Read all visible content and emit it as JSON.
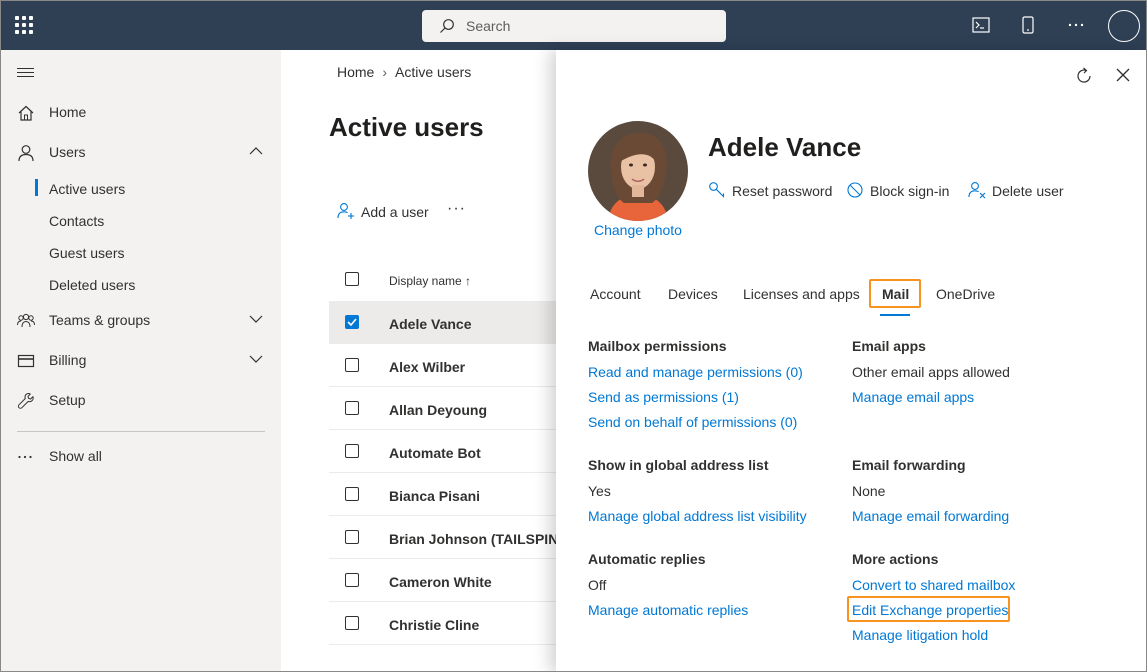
{
  "topbar": {
    "search_placeholder": "Search",
    "icons": [
      "app-launcher-icon",
      "search-icon",
      "terminal-icon",
      "mobile-icon",
      "more-icon",
      "profile-icon"
    ]
  },
  "nav": {
    "home": "Home",
    "users": "Users",
    "active_users": "Active users",
    "contacts": "Contacts",
    "guest_users": "Guest users",
    "deleted_users": "Deleted users",
    "teams_groups": "Teams & groups",
    "billing": "Billing",
    "setup": "Setup",
    "show_all": "Show all"
  },
  "main": {
    "breadcrumb_home": "Home",
    "breadcrumb_current": "Active users",
    "title": "Active users",
    "add_user": "Add a user",
    "more": "···",
    "col_display_name": "Display name ↑",
    "rows": [
      {
        "name": "Adele Vance",
        "selected": true
      },
      {
        "name": "Alex Wilber",
        "selected": false
      },
      {
        "name": "Allan Deyoung",
        "selected": false
      },
      {
        "name": "Automate Bot",
        "selected": false
      },
      {
        "name": "Bianca Pisani",
        "selected": false
      },
      {
        "name": "Brian Johnson (TAILSPIN)",
        "selected": false
      },
      {
        "name": "Cameron White",
        "selected": false
      },
      {
        "name": "Christie Cline",
        "selected": false
      }
    ]
  },
  "panel": {
    "user_name": "Adele Vance",
    "change_photo": "Change photo",
    "reset_password": "Reset password",
    "block_signin": "Block sign-in",
    "delete_user": "Delete user",
    "tabs": [
      "Account",
      "Devices",
      "Licenses and apps",
      "Mail",
      "OneDrive"
    ],
    "active_tab": "Mail",
    "mailbox_permissions": {
      "heading": "Mailbox permissions",
      "read_manage": "Read and manage permissions (0)",
      "send_as": "Send as permissions (1)",
      "send_on_behalf": "Send on behalf of permissions (0)"
    },
    "email_apps": {
      "heading": "Email apps",
      "value": "Other email apps allowed",
      "manage": "Manage email apps"
    },
    "gal": {
      "heading": "Show in global address list",
      "value": "Yes",
      "manage": "Manage global address list visibility"
    },
    "forwarding": {
      "heading": "Email forwarding",
      "value": "None",
      "manage": "Manage email forwarding"
    },
    "auto_replies": {
      "heading": "Automatic replies",
      "value": "Off",
      "manage": "Manage automatic replies"
    },
    "more_actions": {
      "heading": "More actions",
      "convert": "Convert to shared mailbox",
      "edit_exchange": "Edit Exchange properties",
      "litigation": "Manage litigation hold"
    }
  },
  "colors": {
    "topbar": "#2f4055",
    "accent": "#0078d4",
    "highlight": "#f7931e",
    "nav_bg": "#f3f2f1"
  }
}
